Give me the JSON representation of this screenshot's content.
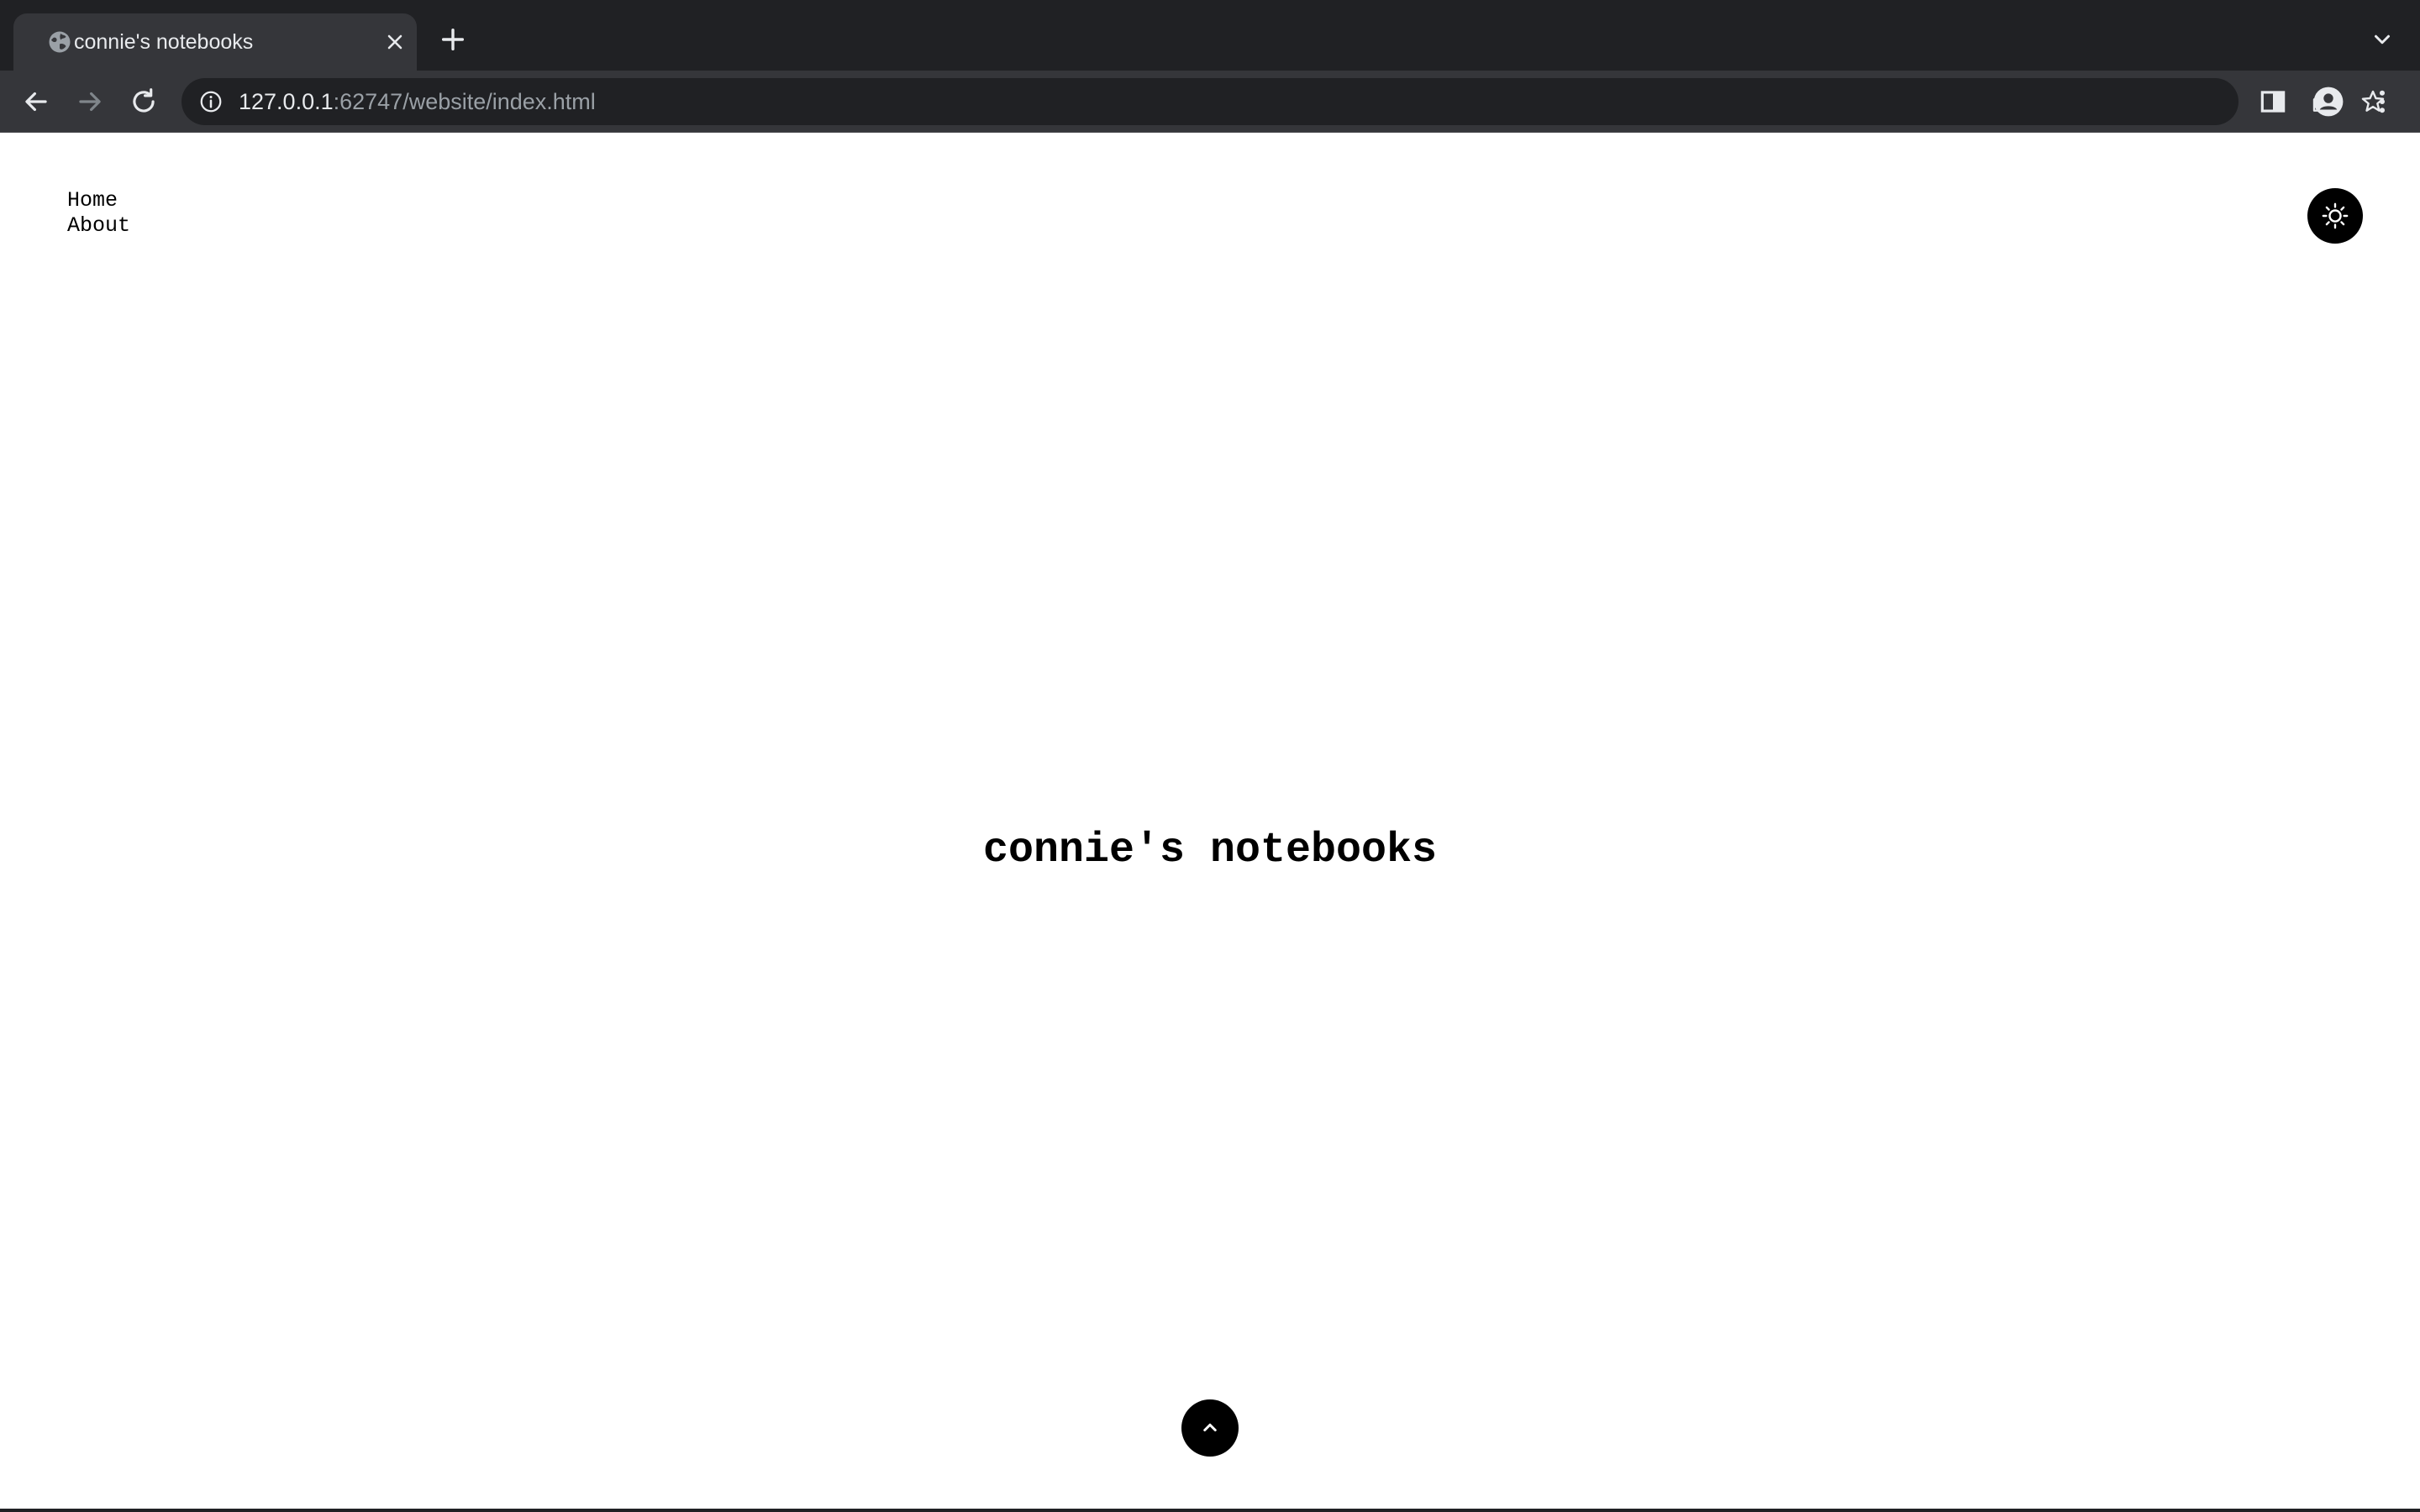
{
  "browser": {
    "tab": {
      "title": "connie's notebooks",
      "favicon": "globe-icon"
    },
    "address_bar": {
      "host": "127.0.0.1",
      "rest": ":62747/website/index.html"
    },
    "icons": {
      "back": "arrow-left-icon",
      "forward": "arrow-right-icon",
      "reload": "reload-icon",
      "site_info": "info-icon",
      "share": "share-icon",
      "bookmark": "star-icon",
      "side_panel": "side-panel-icon",
      "profile": "profile-icon",
      "menu": "kebab-menu-icon",
      "new_tab": "plus-icon",
      "tab_search": "chevron-down-icon"
    },
    "colors": {
      "tabstrip": "#202124",
      "toolbar": "#35363a",
      "omnibox": "#202124",
      "text_primary": "#e8eaed",
      "text_secondary": "#9aa0a6"
    }
  },
  "page": {
    "nav": {
      "home": "Home",
      "about": "About"
    },
    "hero_title": "connie's notebooks",
    "theme_toggle_icon": "sun-icon",
    "scroll_top_icon": "chevron-up-icon",
    "colors": {
      "background": "#ffffff",
      "text": "#000000",
      "button": "#000000"
    }
  }
}
